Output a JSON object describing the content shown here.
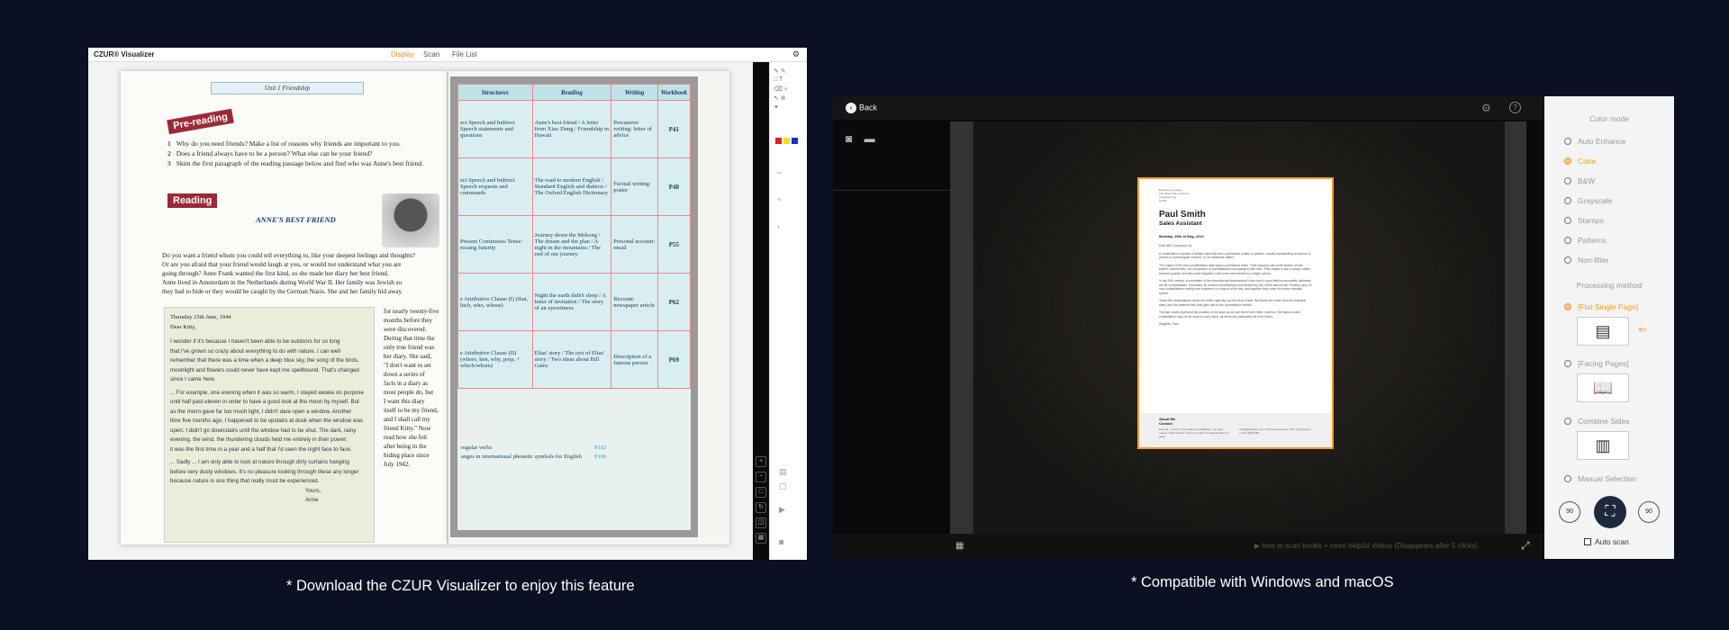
{
  "left_window": {
    "title": "CZUR® Visualizer",
    "tabs": [
      "Display",
      "Scan",
      "File List"
    ],
    "active_tab": "Display",
    "palette_colors": [
      "#e0201a",
      "#f2e21a",
      "#1a2ad0"
    ],
    "book_left": {
      "unit": "Unit 1 Friendship",
      "pre_reading_banner": "Pre-reading",
      "questions": [
        {
          "n": "1",
          "text": "Why do you need friends? Make a list of reasons why friends are important to you."
        },
        {
          "n": "2",
          "text": "Does a friend always have to be a person? What else can be your friend?"
        },
        {
          "n": "3",
          "text": "Skim the first paragraph of the reading passage below and find who was Anne's best friend."
        }
      ],
      "reading_banner": "Reading",
      "story_title": "ANNE'S BEST FRIEND",
      "intro_lines": [
        "Do you want a friend whom you could tell everything to, like your deepest feelings and thoughts?",
        "Or are you afraid that your friend would laugh at you, or would not understand what you are",
        "going through? Anne Frank wanted the first kind, so she made her diary her best friend.",
        "Anne lived in Amsterdam in the Netherlands during World War II. Her family was Jewish so",
        "they had to hide or they would be caught by the German Nazis. She and her family hid away"
      ],
      "diary_date": "Thursday 15th June, 1944",
      "diary_salutation": "Dear Kitty,",
      "diary_lines": [
        "I wonder if it's because I haven't been able to be outdoors for so long",
        "that I've grown so crazy about everything to do with nature. I can well",
        "remember that there was a time when a deep blue sky, the song of the birds,",
        "moonlight and flowers could never have kept me spellbound. That's changed",
        "since I came here.",
        "... For example, one evening when it was so warm, I stayed awake on purpose",
        "until half past eleven in order to have a good look at the moon by myself. But",
        "as the moon gave far too much light, I didn't dare open a window. Another",
        "time five months ago, I happened to be upstairs at dusk when the window was",
        "open. I didn't go downstairs until the window had to be shut. The dark, rainy",
        "evening, the wind, the thundering clouds held me entirely in their power;",
        "it was the first time in a year and a half that I'd seen the night face to face.",
        "... Sadly ... I am only able to look at nature through dirty curtains hanging",
        "before very dusty windows. It's no pleasure looking through these any longer",
        "because nature is one thing that really must be experienced."
      ],
      "diary_signoff": "Yours,",
      "diary_name": "Anne",
      "side_lines": [
        "for nearly twenty-five",
        "months before they",
        "were discovered.",
        "During that time the",
        "only true friend was",
        "her diary. She said,",
        "\"I don't want to set",
        "down a series of",
        "facts in a diary as",
        "most people do, but",
        "I want this diary",
        "itself to be my friend,",
        "and I shall call my",
        "friend Kitty.\" Now",
        "read how she felt",
        "after being in the",
        "hiding place since",
        "July 1942."
      ]
    },
    "book_right": {
      "headers": [
        "Structures",
        "Reading",
        "Writing",
        "Workbook"
      ],
      "rows": [
        {
          "structures": "ect Speech and Indirect Speech statements and questions",
          "reading": "Anne's best friend / A letter from Xiao Dong / Friendship in Hawaii",
          "writing": "Persuasive writing: letter of advice",
          "workbook": "P41"
        },
        {
          "structures": "ect Speech and Indirect Speech requests and commands",
          "reading": "The road to modern English / Standard English and dialects / The Oxford English Dictionary",
          "writing": "Factual writing: poster",
          "workbook": "P48"
        },
        {
          "structures": "Present Continuous Tense: ressing futurity",
          "reading": "Journey down the Mekong / The dream and the plan / A night in the mountains / The end of our journey",
          "writing": "Personal account: email",
          "workbook": "P55"
        },
        {
          "structures": "e Attributive Clause (I) (that, hich, who, whose)",
          "reading": "Night the earth didn't sleep / A letter of invitation / The story of an eyewitness",
          "writing": "Recount: newspaper article",
          "workbook": "P62"
        },
        {
          "structures": "e Attributive Clause (II) (where, hen, why, prep. + which/whom)",
          "reading": "Elias' story / The rest of Elias' story / Two ideas about Bill Gates",
          "writing": "Description of a famous person",
          "workbook": "P69"
        }
      ],
      "footer": [
        {
          "text": "regular verbs",
          "page": "P103"
        },
        {
          "text": "anges in international phonetic symbols for English",
          "page": "P106"
        }
      ]
    }
  },
  "right_window": {
    "back_label": "Back",
    "document": {
      "address_lines": [
        "Business Company",
        "123 Street Name Avenue",
        "Anywhere City",
        "12345"
      ],
      "name": "Paul Smith",
      "role": "Sales Assistant",
      "date": "Monday, 15th of May, 2022",
      "salutation": "Dear ABC Company Ltd,",
      "body": [
        "A constellation consists of visible stars that form a perceived outline or pattern, usually representing an animal, a person or mythological creature, or an inanimate object.",
        "The origins of the first constellations date back to prehistoric times. Their purpose was to tell stories of their beliefs, experiences, the recognition of constellations has changed over time. They create a star or shape others become popular and then were forgotten until some were limited to a single culture.",
        "In the 20th century, a committee of the International Astronomical Union took it upon itself to accurately delineate the 88 constellations. It included 48 ancient constellations enumerated by the Greek astronomer Ptolemy, plus 40 new constellations mainly from explorers in a region of the sky, and together they cover the entire celestial sphere.",
        "These 88 constellations divide the entire night sky as seen from Earth. But these are made from the brightest stars, and the patterns they form give rise to the constellation names.",
        "The star charts represent the position of the stars as we see them from Earth; however, the stars in each constellation may not be close to each other, as some are particularly far from Earth.",
        "Regards, Paul"
      ],
      "footer_left_title": "About Me",
      "footer_left_text": "Anyone ... is one of the oldest constellations. its name means \"water bearer\" and its symbol is a representation of water.",
      "footer_right_title": "Contact",
      "footer_right_text": "email@website.com / 123 Street Avenue, 123 / City,Country / +012-345-6789"
    },
    "tip": "how to scan books + more helpful videos (Disappears after 5 clicks)",
    "panel": {
      "color_mode_title": "Color mode",
      "color_modes": [
        "Auto Enhance",
        "Color",
        "B&W",
        "Grayscale",
        "Stamps",
        "Patterns",
        "Non-filter"
      ],
      "selected_color_mode": "Color",
      "processing_title": "Processing method",
      "processing_methods": [
        "[Flat Single Page]",
        "[Facing Pages]",
        "Combine Sides",
        "Manual Selection"
      ],
      "selected_processing": "[Flat Single Page]",
      "rotate_left": "90",
      "rotate_right": "90",
      "auto_scan_label": "Auto scan",
      "accent_color": "#f0a023"
    }
  },
  "captions": {
    "left": "* Download the CZUR Visualizer to enjoy this feature",
    "right": "* Compatible with Windows and macOS"
  }
}
